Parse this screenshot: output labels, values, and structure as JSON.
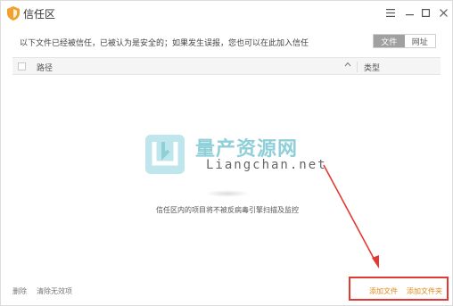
{
  "window": {
    "title": "信任区"
  },
  "info": {
    "text": "以下文件已经被信任，已被认为是安全的；如果发生误报，您也可以在此加入信任"
  },
  "tabs": [
    {
      "label": "文件",
      "active": true
    },
    {
      "label": "网址",
      "active": false
    }
  ],
  "table": {
    "columns": [
      "路径",
      "类型"
    ]
  },
  "empty_state": {
    "message": "信任区内的项目将不被反病毒引擎扫描及监控"
  },
  "watermark": {
    "title": "量产资源网",
    "url": "Liangchan.net"
  },
  "footer": {
    "delete_label": "删除",
    "clear_invalid_label": "清除无效项",
    "add_file_label": "添加文件",
    "add_folder_label": "添加文件夹"
  },
  "colors": {
    "accent_orange": "#e08a1e",
    "highlight_red": "#e23a32",
    "active_tab_bg": "#a0a0a0",
    "watermark_teal": "#8fcfd8"
  },
  "icons": {
    "app": "shield-icon",
    "menu": "hamburger-menu-icon",
    "minimize": "minimize-icon",
    "maximize": "maximize-icon",
    "close": "close-icon",
    "sort": "chevron-up-icon"
  }
}
